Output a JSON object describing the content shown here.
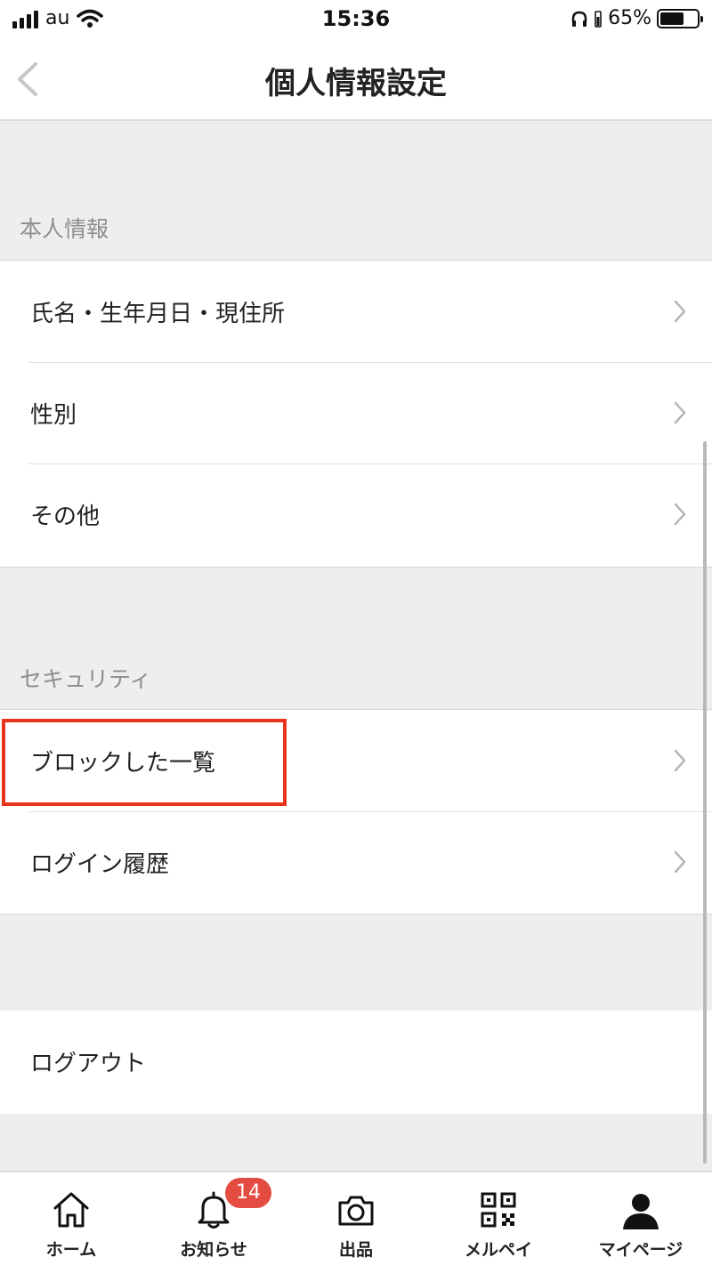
{
  "status_bar": {
    "carrier": "au",
    "time": "15:36",
    "battery_text": "65%",
    "battery_level": 0.65
  },
  "nav": {
    "title": "個人情報設定",
    "back_icon": "chevron-left-icon"
  },
  "sections": {
    "personal": {
      "header": "本人情報",
      "items": [
        {
          "label": "氏名・生年月日・現住所"
        },
        {
          "label": "性別"
        },
        {
          "label": "その他"
        }
      ]
    },
    "security": {
      "header": "セキュリティ",
      "items": [
        {
          "label": "ブロックした一覧"
        },
        {
          "label": "ログイン履歴"
        }
      ]
    },
    "logout": {
      "label": "ログアウト"
    }
  },
  "tab_bar": {
    "tabs": [
      {
        "label": "ホーム",
        "icon": "home-icon"
      },
      {
        "label": "お知らせ",
        "icon": "bell-icon",
        "badge": "14"
      },
      {
        "label": "出品",
        "icon": "camera-icon"
      },
      {
        "label": "メルペイ",
        "icon": "qr-code-icon"
      },
      {
        "label": "マイページ",
        "icon": "user-icon"
      }
    ]
  },
  "colors": {
    "highlight": "#e8341c",
    "badge": "#e44c41",
    "background": "#eeeeee"
  }
}
